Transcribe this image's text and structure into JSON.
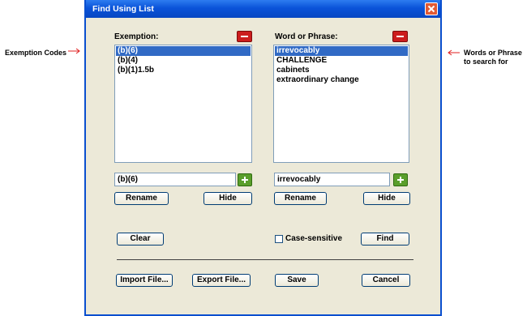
{
  "annotations": {
    "left": "Exemption Codes",
    "right_line1": "Words or Phrase",
    "right_line2": "to search for"
  },
  "dialog": {
    "title": "Find Using List"
  },
  "exemption": {
    "label": "Exemption:",
    "items": [
      "(b)(6)",
      "(b)(4)",
      "(b)(1)1.5b"
    ],
    "selected_index": 0,
    "input_value": "(b)(6)",
    "rename_label": "Rename",
    "hide_label": "Hide"
  },
  "phrase": {
    "label": "Word or Phrase:",
    "items": [
      "irrevocably",
      "CHALLENGE",
      "cabinets",
      "extraordinary change"
    ],
    "selected_index": 0,
    "input_value": "irrevocably",
    "rename_label": "Rename",
    "hide_label": "Hide"
  },
  "actions": {
    "clear_label": "Clear",
    "case_sensitive_label": "Case-sensitive",
    "case_sensitive_checked": false,
    "find_label": "Find"
  },
  "footer": {
    "import_label": "Import File...",
    "export_label": "Export File...",
    "save_label": "Save",
    "cancel_label": "Cancel"
  },
  "colors": {
    "titlebar": "#0a53d9",
    "selection": "#316ac5",
    "remove_button": "#cc1d1d",
    "add_button": "#5a9e2b",
    "annotation_arrow": "#e02020"
  }
}
